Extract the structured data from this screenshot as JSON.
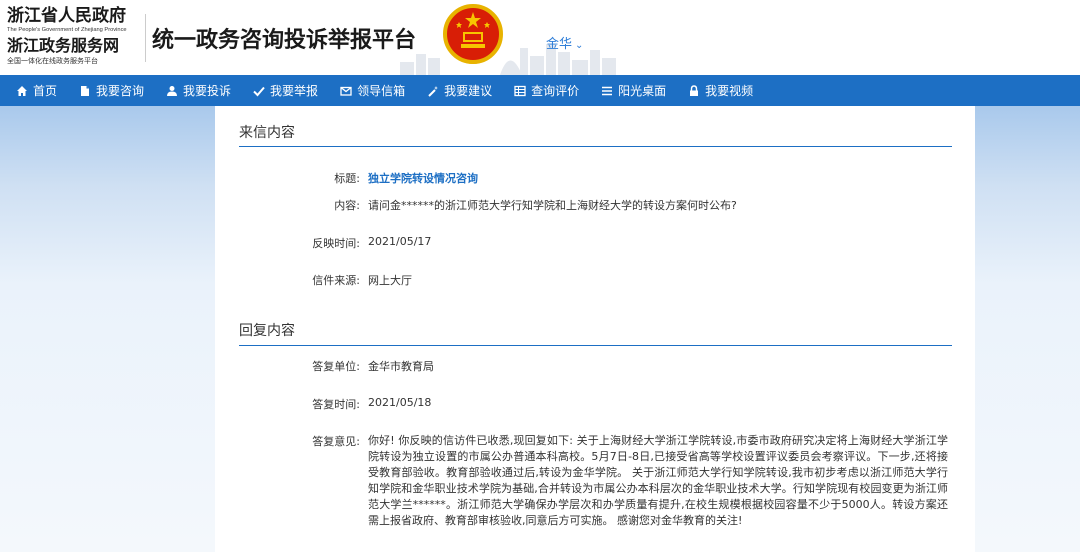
{
  "header": {
    "gov_name": "浙江省人民政府",
    "gov_name_en": "The People's Government of Zhejiang Province",
    "service_name": "浙江政务服务网",
    "service_sub": "全国一体化在线政务服务平台",
    "site_title": "统一政务咨询投诉举报平台",
    "region": "金华",
    "region_icon": "chevron-down-icon"
  },
  "nav": [
    {
      "label": "首页",
      "icon": "home-icon"
    },
    {
      "label": "我要咨询",
      "icon": "document-icon"
    },
    {
      "label": "我要投诉",
      "icon": "user-icon"
    },
    {
      "label": "我要举报",
      "icon": "check-icon"
    },
    {
      "label": "领导信箱",
      "icon": "mail-icon"
    },
    {
      "label": "我要建议",
      "icon": "wand-icon"
    },
    {
      "label": "查询评价",
      "icon": "table-icon"
    },
    {
      "label": "阳光桌面",
      "icon": "list-icon"
    },
    {
      "label": "我要视频",
      "icon": "lock-icon"
    }
  ],
  "letter": {
    "section_title": "来信内容",
    "title_label": "标题:",
    "title_value": "独立学院转设情况咨询",
    "content_label": "内容:",
    "content_value": "请问金******的浙江师范大学行知学院和上海财经大学的转设方案何时公布?",
    "time_label": "反映时间:",
    "time_value": "2021/05/17",
    "source_label": "信件来源:",
    "source_value": "网上大厅"
  },
  "reply": {
    "section_title": "回复内容",
    "unit_label": "答复单位:",
    "unit_value": "金华市教育局",
    "time_label": "答复时间:",
    "time_value": "2021/05/18",
    "opinion_label": "答复意见:",
    "opinion_value": "你好! 你反映的信访件已收悉,现回复如下: 关于上海财经大学浙江学院转设,市委市政府研究决定将上海财经大学浙江学院转设为独立设置的市属公办普通本科高校。5月7日-8日,已接受省高等学校设置评议委员会考察评议。下一步,还将接受教育部验收。教育部验收通过后,转设为金华学院。 关于浙江师范大学行知学院转设,我市初步考虑以浙江师范大学行知学院和金华职业技术学院为基础,合并转设为市属公办本科层次的金华职业技术大学。行知学院现有校园变更为浙江师范大学兰******。浙江师范大学确保办学层次和办学质量有提升,在校生规模根据校园容量不少于5000人。转设方案还需上报省政府、教育部审核验收,同意后方可实施。 感谢您对金华教育的关注!"
  },
  "colors": {
    "nav_bg": "#1d6fc4",
    "link": "#1d6fc4",
    "region": "#2f7ed8"
  }
}
